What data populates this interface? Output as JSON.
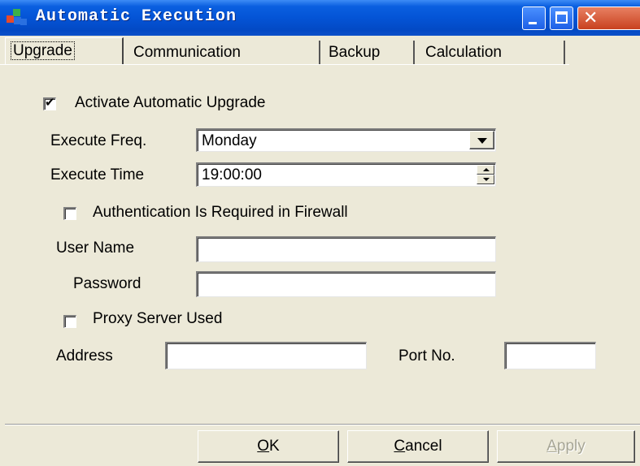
{
  "window": {
    "title": "Automatic Execution",
    "title_bar_color": "#0454d6"
  },
  "tabs": [
    {
      "label": "Upgrade",
      "active": true
    },
    {
      "label": "Communication",
      "active": false
    },
    {
      "label": "Backup",
      "active": false
    },
    {
      "label": "Calculation",
      "active": false
    }
  ],
  "upgrade": {
    "activate_label": "Activate Automatic Upgrade",
    "activate_checked": true,
    "execute_freq_label": "Execute Freq.",
    "execute_freq_value": "Monday",
    "execute_time_label": "Execute Time",
    "execute_time_value": "19:00:00",
    "auth_label": "Authentication Is Required in Firewall",
    "auth_checked": false,
    "username_label": "User Name",
    "username_value": "",
    "password_label": "Password",
    "password_value": "",
    "proxy_label": "Proxy Server Used",
    "proxy_checked": false,
    "address_label": "Address",
    "address_value": "",
    "port_label": "Port No.",
    "port_value": ""
  },
  "buttons": {
    "ok_hotkey": "O",
    "ok_rest": "K",
    "cancel_hotkey": "C",
    "cancel_rest": "ancel",
    "apply_hotkey": "A",
    "apply_rest": "pply",
    "apply_disabled": true
  },
  "icons": {
    "app": "app-blocks-icon",
    "check": "checkmark-icon",
    "minimize": "minimize-icon",
    "maximize": "maximize-icon",
    "close": "close-icon"
  }
}
